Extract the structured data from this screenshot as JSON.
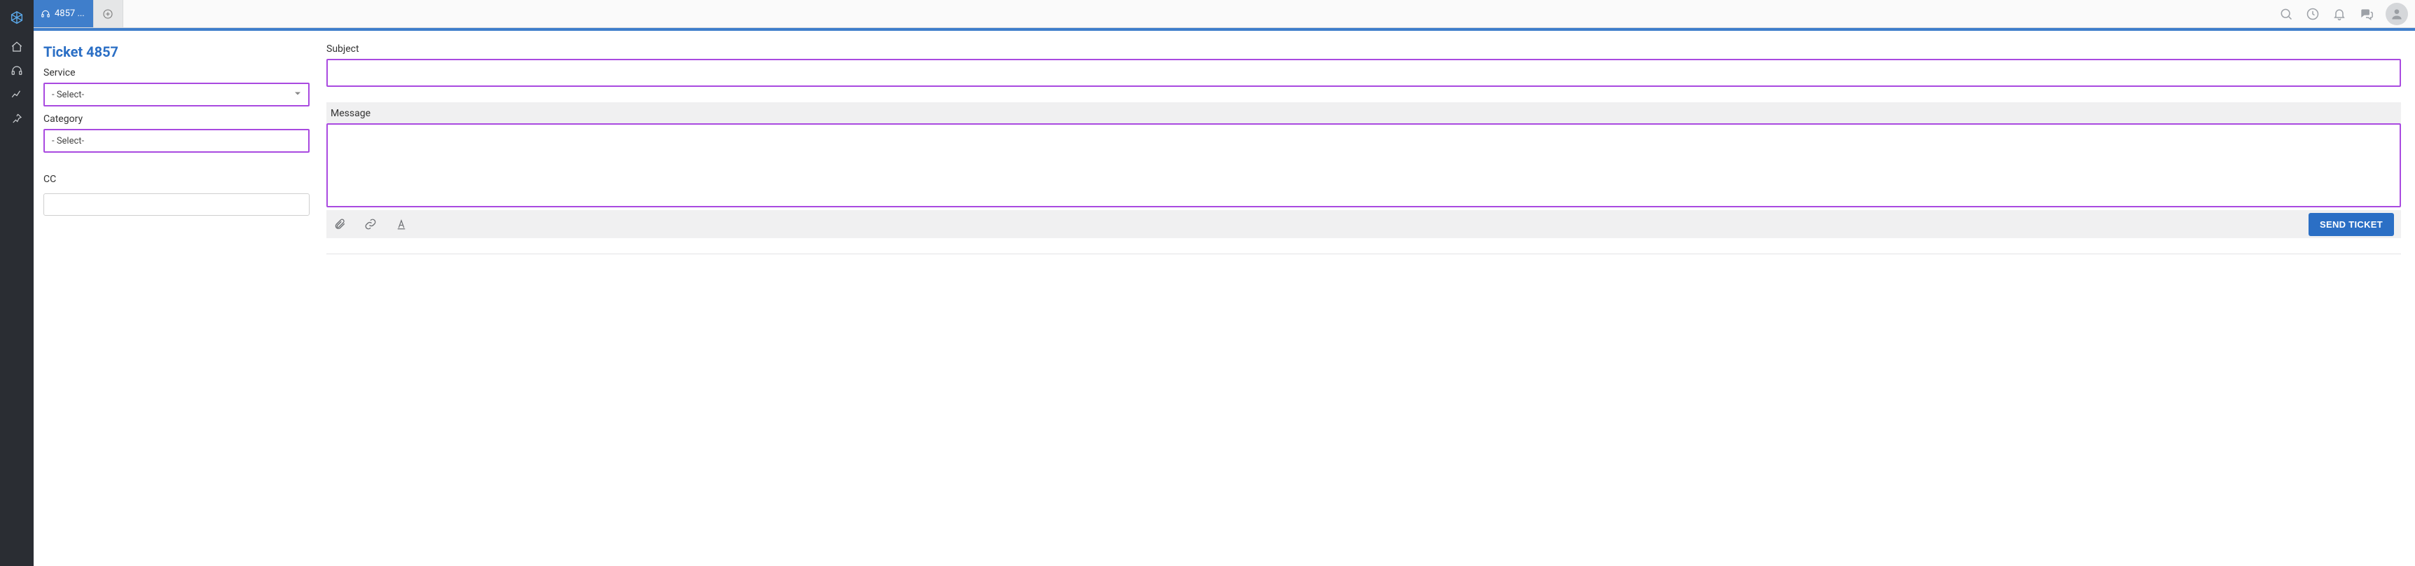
{
  "tabs": {
    "active_label": "4857 ..."
  },
  "page": {
    "title": "Ticket 4857"
  },
  "left": {
    "service_label": "Service",
    "service_value": "- Select-",
    "category_label": "Category",
    "category_value": "- Select-",
    "cc_label": "CC",
    "cc_value": ""
  },
  "right": {
    "subject_label": "Subject",
    "subject_value": "",
    "message_label": "Message",
    "message_value": "",
    "send_label": "SEND TICKET"
  },
  "colors": {
    "accent": "#3f7ecb",
    "highlight_border": "#a94ae0"
  }
}
